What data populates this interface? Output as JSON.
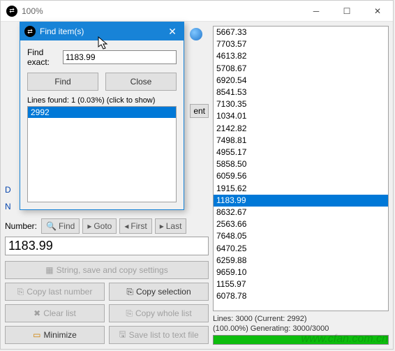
{
  "window": {
    "title": "100%"
  },
  "dialog": {
    "title": "Find item(s)",
    "find_exact_label": "Find exact:",
    "find_exact_value": "1183.99",
    "find_btn": "Find",
    "close_btn": "Close",
    "found_text": "Lines found: 1 (0.03%) (click to show)",
    "results": [
      "2992"
    ]
  },
  "left": {
    "d_label": "D",
    "n_label": "N",
    "ent_fragment": "ent",
    "number_label": "Number:",
    "find_btn": "Find",
    "goto_btn": "Goto",
    "first_btn": "First",
    "last_btn": "Last",
    "number_value": "1183.99",
    "ssc_btn": "String, save and copy settings",
    "copy_last": "Copy last number",
    "copy_sel": "Copy selection",
    "clear_list": "Clear list",
    "copy_whole": "Copy whole list",
    "minimize": "Minimize",
    "save_txt": "Save list to text file"
  },
  "list": {
    "items": [
      "5667.33",
      "7703.57",
      "4613.82",
      "5708.67",
      "6920.54",
      "8541.53",
      "7130.35",
      "1034.01",
      "2142.82",
      "7498.81",
      "4955.17",
      "5858.50",
      "6059.56",
      "1915.62",
      "1183.99",
      "8632.67",
      "2563.66",
      "7648.05",
      "6470.25",
      "6259.88",
      "9659.10",
      "1155.97",
      "6078.78"
    ],
    "selected_index": 14
  },
  "status": {
    "lines": "Lines: 3000 (Current: 2992)",
    "gen": "(100.00%) Generating: 3000/3000"
  },
  "watermark": "www.cfan.com.cn"
}
